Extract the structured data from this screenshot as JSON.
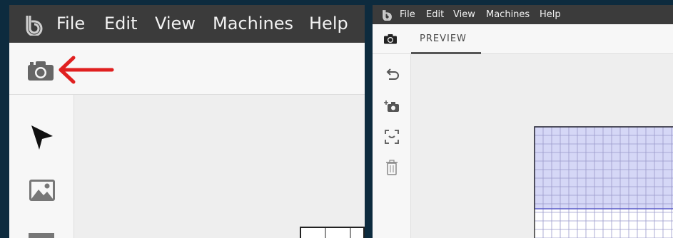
{
  "left_panel": {
    "menu": [
      "File",
      "Edit",
      "View",
      "Machines",
      "Help"
    ],
    "toolbar": {
      "camera_icon": "camera-icon",
      "annotation": "red-arrow-icon",
      "annotation_color": "#e02020"
    },
    "tools": [
      "cursor-icon",
      "image-icon",
      "text-tool-icon"
    ]
  },
  "right_panel": {
    "menu": [
      "File",
      "Edit",
      "View",
      "Machines",
      "Help"
    ],
    "tabs": {
      "camera_icon": "camera-icon",
      "preview_label": "PREVIEW"
    },
    "tools": [
      "undo-icon",
      "add-photo-icon",
      "focus-frame-icon",
      "trash-icon"
    ],
    "workarea": {
      "fill_color": "#d5d7f6",
      "border_color": "#5a5ac8"
    }
  },
  "colors": {
    "menubar": "#3b3b3b",
    "background": "#0d2b3e"
  }
}
